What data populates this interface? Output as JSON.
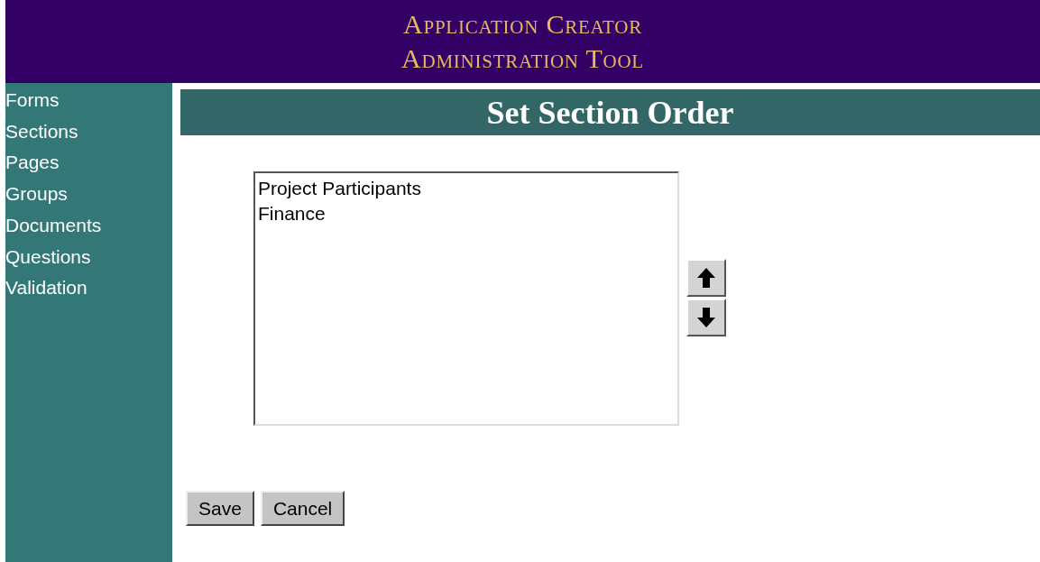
{
  "header": {
    "title_lines": [
      "Application Creator",
      "Administration Tool"
    ]
  },
  "sidebar": {
    "items": [
      "Forms",
      "Sections",
      "Pages",
      "Groups",
      "Documents",
      "Questions",
      "Validation"
    ]
  },
  "page_title": "Set Section Order",
  "section_list": {
    "items": [
      "Project Participants",
      "Finance"
    ]
  },
  "buttons": [
    "Save",
    "Cancel"
  ]
}
